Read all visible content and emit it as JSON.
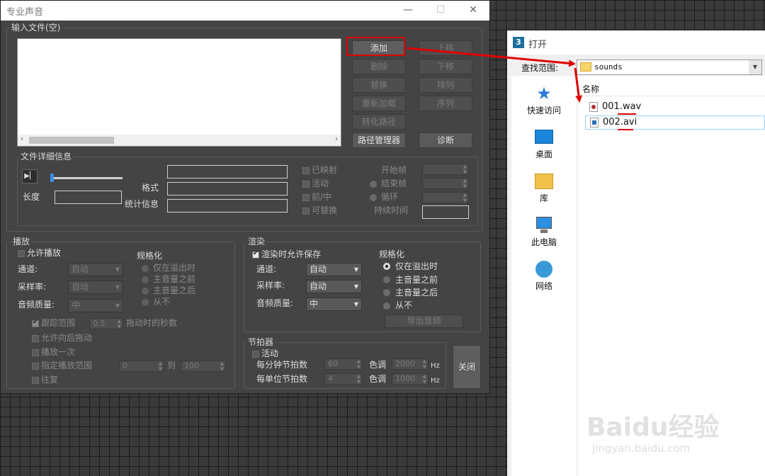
{
  "dialog": {
    "title": "专业声音",
    "min": "—",
    "max": "☐",
    "close": "✕"
  },
  "input_files": {
    "label": "输入文件(空)",
    "buttons": {
      "add": "添加",
      "move_up": "上移",
      "delete": "删除",
      "move_down": "下移",
      "replace": "替换",
      "sort": "排列",
      "reload": "重新加载",
      "sequence": "序列",
      "convert_path": "转化路径",
      "path_manager": "路径管理器",
      "diagnose": "诊断"
    }
  },
  "file_details": {
    "label": "文件详细信息",
    "length_label": "长度",
    "format_label": "格式",
    "stats_label": "统计信息",
    "mapped": "已映射",
    "active": "活动",
    "front_mid": "前/中",
    "replaceable": "可替换",
    "start_frame": "开始帧",
    "end_frame": "结束帧",
    "loop": "循环",
    "duration": "持续时间"
  },
  "playback": {
    "label": "播放",
    "allow_playback": "允许播放",
    "channel_label": "通道:",
    "channel_value": "自动",
    "sample_rate_label": "采样率:",
    "sample_rate_value": "自动",
    "quality_label": "音频质量:",
    "quality_value": "中",
    "normalize_label": "规格化",
    "norm_options": [
      "仅在溢出时",
      "主音量之前",
      "主音量之后",
      "从不"
    ],
    "track_range": "跟踪范围",
    "track_value": "0.5",
    "drag_seconds": "拖动时的秒数",
    "allow_drag_back": "允许向后拖动",
    "play_once": "播放一次",
    "specify_range": "指定播放范围",
    "range_from": "0",
    "range_to_label": "到",
    "range_to": "100",
    "loop": "往复"
  },
  "render": {
    "label": "渲染",
    "allow_save": "渲染时允许保存",
    "channel_label": "通道:",
    "channel_value": "自动",
    "sample_rate_label": "采样率:",
    "sample_rate_value": "自动",
    "quality_label": "音频质量:",
    "quality_value": "中",
    "normalize_label": "规格化",
    "norm_options": [
      "仅在溢出时",
      "主音量之前",
      "主音量之后",
      "从不"
    ],
    "export_audio": "导出音频"
  },
  "metronome": {
    "label": "节拍器",
    "active": "活动",
    "bpm_label": "每分钟节拍数",
    "bpm_value": "60",
    "bpu_label": "每单位节拍数",
    "bpu_value": "4",
    "tone_label": "色调",
    "tone1_value": "2000",
    "tone2_value": "1000",
    "hz": "Hz"
  },
  "close_button": "关闭",
  "open_dialog": {
    "title": "打开",
    "look_in_label": "查找范围:",
    "folder": "sounds",
    "column_name": "名称",
    "sidebar": [
      "快速访问",
      "桌面",
      "库",
      "此电脑",
      "网络"
    ],
    "files": [
      "001.wav",
      "002.avi"
    ]
  },
  "watermark": {
    "brand": "Baidu经验",
    "url": "jingyan.baidu.com"
  },
  "colors": {
    "highlight_red": "#e00000",
    "dialog_bg": "#444444"
  }
}
